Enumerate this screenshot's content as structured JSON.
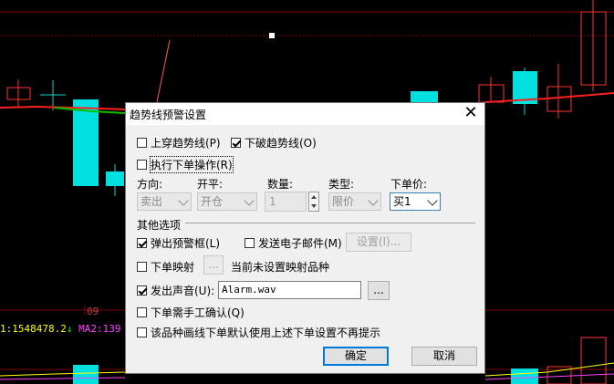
{
  "chart": {
    "price_label_01": "09",
    "indicator_value": "1:1548478.2",
    "indicator_arrow": "↓",
    "ma2_label": "MA2:139",
    "colors": {
      "up": "#ff3232",
      "down": "#00d4d4",
      "ma1": "#ff2020",
      "ma2": "#00c000"
    }
  },
  "dialog": {
    "title": "趋势线预警设置",
    "close_glyph": "✕",
    "cross_up": {
      "label": "上穿趋势线(P)",
      "checked": false
    },
    "cross_down": {
      "label": "下破趋势线(O)",
      "checked": true
    },
    "execute_order": {
      "label": "执行下单操作(R)",
      "checked": false
    },
    "order": {
      "direction_label": "方向:",
      "direction_value": "卖出",
      "open_close_label": "开平:",
      "open_close_value": "开仓",
      "qty_label": "数量:",
      "qty_value": "1",
      "type_label": "类型:",
      "type_value": "限价",
      "price_label": "下单价:",
      "price_value": "买1"
    },
    "other_options_label": "其他选项",
    "popup_alert": {
      "label": "弹出预警框(L)",
      "checked": true
    },
    "send_email": {
      "label": "发送电子邮件(M)",
      "checked": false
    },
    "email_settings_button": "设置(I)...",
    "order_mapping": {
      "label": "下单映射",
      "checked": false
    },
    "mapping_button": "...",
    "mapping_status": "当前未设置映射品种",
    "play_sound": {
      "label": "发出声音(U):",
      "checked": true
    },
    "sound_file": "Alarm.wav",
    "browse_button": "...",
    "manual_confirm": {
      "label": "下单需手工确认(Q)",
      "checked": false
    },
    "no_prompt": {
      "label": "该品种画线下单默认使用上述下单设置不再提示",
      "checked": false
    },
    "ok_button": "确定",
    "cancel_button": "取消"
  }
}
